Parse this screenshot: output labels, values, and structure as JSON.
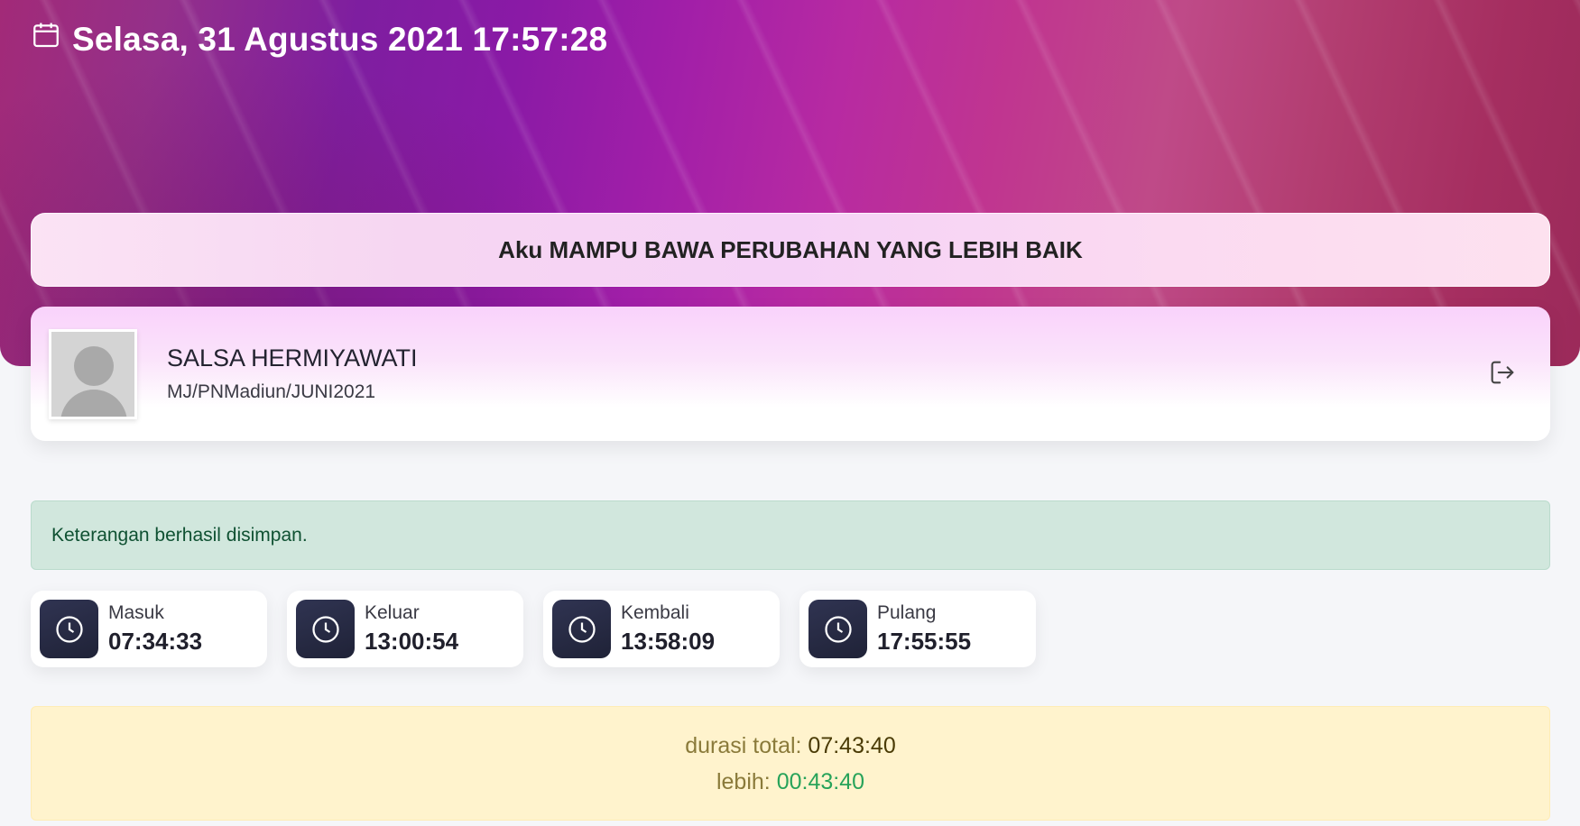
{
  "header": {
    "datetime": "Selasa, 31 Agustus 2021 17:57:28",
    "calendar_icon": "calendar-icon"
  },
  "motto": "Aku MAMPU BAWA PERUBAHAN YANG LEBIH BAIK",
  "profile": {
    "name": "SALSA HERMIYAWATI",
    "id": "MJ/PNMadiun/JUNI2021",
    "avatar_icon": "user-placeholder-icon",
    "logout_icon": "logout-icon"
  },
  "alerts": {
    "success": "Keterangan berhasil disimpan."
  },
  "times": [
    {
      "label": "Masuk",
      "value": "07:34:33",
      "icon": "clock-icon"
    },
    {
      "label": "Keluar",
      "value": "13:00:54",
      "icon": "clock-icon"
    },
    {
      "label": "Kembali",
      "value": "13:58:09",
      "icon": "clock-icon"
    },
    {
      "label": "Pulang",
      "value": "17:55:55",
      "icon": "clock-icon"
    }
  ],
  "summary": {
    "total_label": "durasi total: ",
    "total_value": "07:43:40",
    "extra_label": "lebih: ",
    "extra_value": "00:43:40"
  },
  "colors": {
    "success_bg": "#d1e7dd",
    "warning_bg": "#fff3cd",
    "extra_value_color": "#27a35a",
    "clock_tile": "#2a2d47"
  }
}
